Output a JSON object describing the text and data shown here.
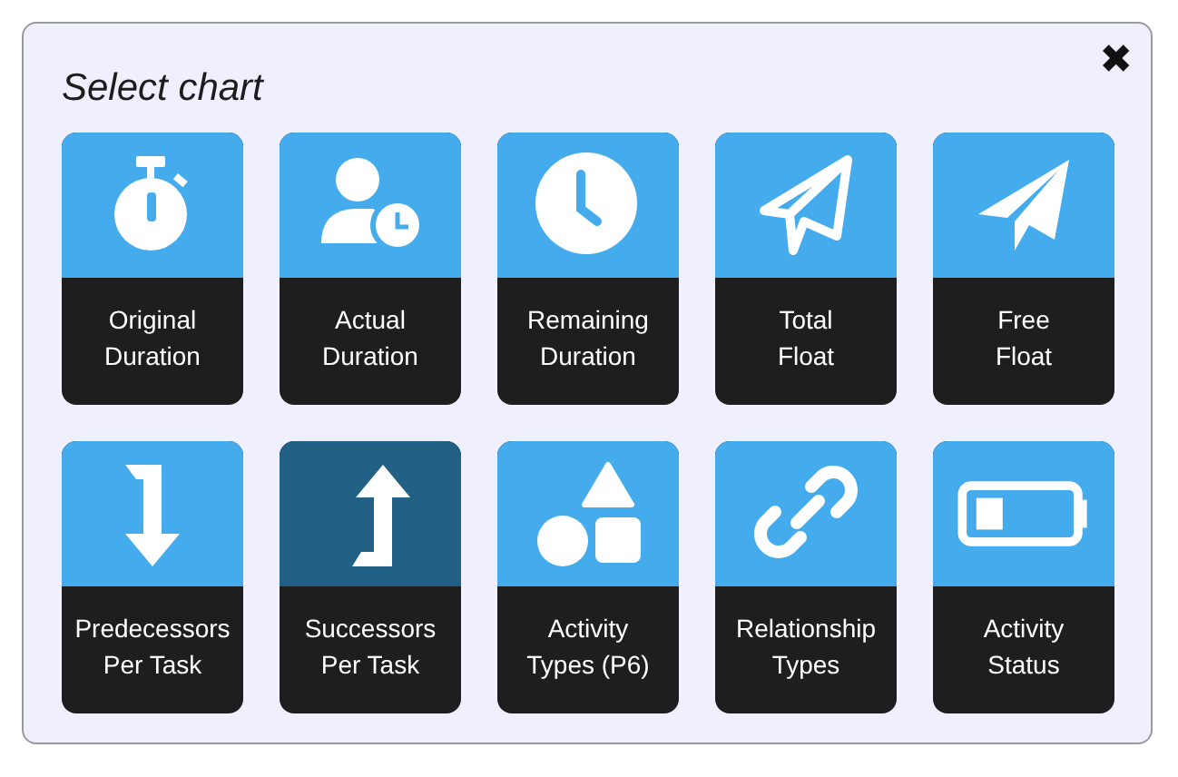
{
  "dialog": {
    "title": "Select chart",
    "close": "✖"
  },
  "tiles": [
    {
      "label": "Original\nDuration",
      "kind": "stopwatch",
      "selected": false
    },
    {
      "label": "Actual\nDuration",
      "kind": "user-clock",
      "selected": false
    },
    {
      "label": "Remaining\nDuration",
      "kind": "clock",
      "selected": false
    },
    {
      "label": "Total\nFloat",
      "kind": "plane-outline",
      "selected": false
    },
    {
      "label": "Free\nFloat",
      "kind": "plane",
      "selected": false
    },
    {
      "label": "Predecessors\nPer Task",
      "kind": "arrow-down",
      "selected": false
    },
    {
      "label": "Successors\nPer Task",
      "kind": "arrow-up",
      "selected": true
    },
    {
      "label": "Activity\nTypes (P6)",
      "kind": "shapes",
      "selected": false
    },
    {
      "label": "Relationship\nTypes",
      "kind": "link",
      "selected": false
    },
    {
      "label": "Activity\nStatus",
      "kind": "battery",
      "selected": false
    }
  ]
}
